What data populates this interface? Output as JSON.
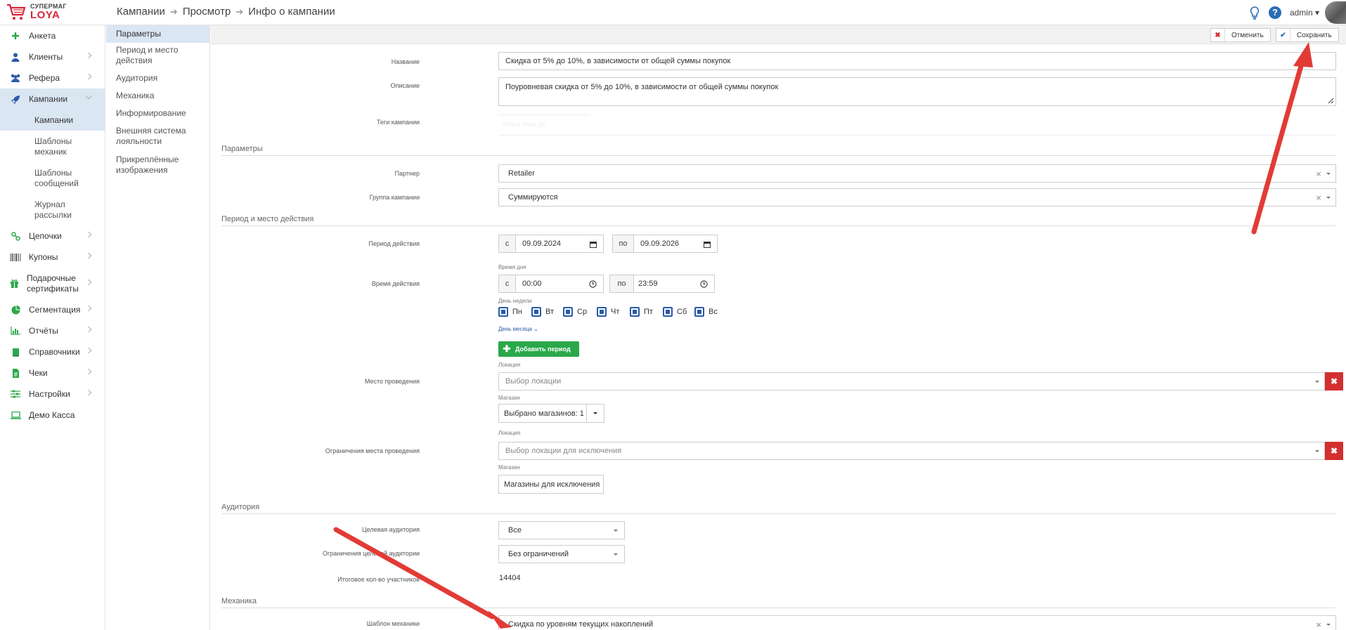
{
  "brand": {
    "line1": "СУПЕРМАГ",
    "line2": "LOYA"
  },
  "breadcrumb": [
    "Кампании",
    "Просмотр",
    "Инфо о кампании"
  ],
  "user": {
    "name": "admin"
  },
  "colors": {
    "accent": "#2a5aa8",
    "danger": "#d42f2f",
    "success": "#2aa84a",
    "active_bg": "#dbe6f3"
  },
  "sidebar": {
    "items": [
      {
        "label": "Анкета",
        "icon": "plus-icon"
      },
      {
        "label": "Клиенты",
        "icon": "user-icon"
      },
      {
        "label": "Рефера",
        "icon": "users-icon"
      },
      {
        "label": "Кампании",
        "icon": "rocket-icon"
      },
      {
        "label": "Цепочки",
        "icon": "chain-icon"
      },
      {
        "label": "Купоны",
        "icon": "barcode-icon"
      },
      {
        "label": "Подарочные сертификаты",
        "icon": "gift-icon"
      },
      {
        "label": "Сегментация",
        "icon": "pie-chart-icon"
      },
      {
        "label": "Отчёты",
        "icon": "bar-chart-icon"
      },
      {
        "label": "Справочники",
        "icon": "book-icon"
      },
      {
        "label": "Чеки",
        "icon": "receipt-icon"
      },
      {
        "label": "Настройки",
        "icon": "sliders-icon"
      },
      {
        "label": "Демо Касса",
        "icon": "laptop-icon"
      }
    ],
    "campaign_sub": [
      "Кампании",
      "Шаблоны механик",
      "Шаблоны сообщений",
      "Журнал рассылки"
    ]
  },
  "subnav": [
    "Параметры",
    "Период и место действия",
    "Аудитория",
    "Механика",
    "Информирование",
    "Внешняя система лояльности",
    "Прикреплённые изображения"
  ],
  "toolbar": {
    "cancel": "Отменить",
    "save": "Сохранить"
  },
  "form": {
    "name_label": "Название",
    "name_value": "Скидка от 5% до 10%, в зависимости от общей суммы покупок",
    "desc_label": "Описание",
    "desc_value": "Поуровневая скидка от 5% до 10%, в зависимости от общей суммы покупок",
    "tags_label": "Теги кампании",
    "tags_placeholder": "Теги и типы (a)",
    "section_params": "Параметры",
    "partner_label": "Партнер",
    "partner_value": "Retailer",
    "group_label": "Группа кампании",
    "group_value": "Суммируются",
    "section_period": "Период и место действия",
    "period_label": "Период действия",
    "prefix_from": "с",
    "prefix_to": "по",
    "date_from": "09.09.2024",
    "date_to": "09.09.2026",
    "time_of_day": "Время дня",
    "time_label": "Время действия",
    "time_from": "00:00",
    "time_to": "23:59",
    "weekday_caption": "День недели",
    "weekdays": [
      "Пн",
      "Вт",
      "Ср",
      "Чт",
      "Пт",
      "Сб",
      "Вс"
    ],
    "month_day_link": "День месяца",
    "add_period": "Добавить период",
    "location_caption": "Локация",
    "place_label": "Место проведения",
    "place_placeholder": "Выбор локации",
    "shop_caption": "Магазин",
    "shops_selected": "Выбрано магазинов: 1",
    "location_caption2": "Локация",
    "restrict_label": "Ограничения места проведения",
    "restrict_placeholder": "Выбор локации для исключения",
    "shop_caption2": "Магазин",
    "exclude_shops": "Магазины для исключения",
    "section_audience": "Аудитория",
    "audience_label": "Целевая аудитория",
    "audience_value": "Все",
    "aud_restrict_label": "Ограничения целевой аудитории",
    "aud_restrict_value": "Без ограничений",
    "participants_label": "Итоговое кол-во участников",
    "participants_value": "14404",
    "section_mechanic": "Механика",
    "mechanic_label": "Шаблон механики",
    "mechanic_value": "Скидка по уровням текущих накоплений"
  }
}
